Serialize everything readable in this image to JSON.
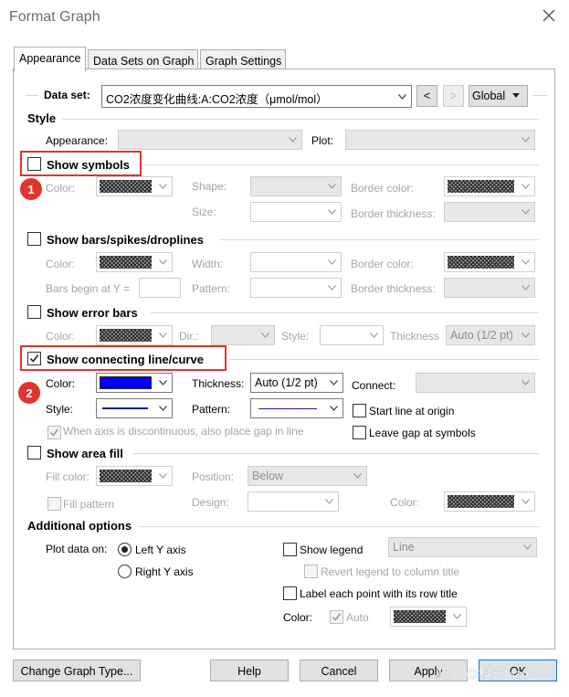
{
  "window": {
    "title": "Format Graph"
  },
  "tabs": [
    "Appearance",
    "Data Sets on Graph",
    "Graph Settings"
  ],
  "dataset": {
    "label": "Data set:",
    "value": "CO2浓度变化曲线:A:CO2浓度（μmol/mol）",
    "prev": "<",
    "next": ">",
    "scope": "Global"
  },
  "style": {
    "heading": "Style",
    "appearance_label": "Appearance:",
    "appearance_value": "",
    "plot_label": "Plot:",
    "plot_value": ""
  },
  "symbols": {
    "heading": "Show symbols",
    "checked": false,
    "color_label": "Color:",
    "shape_label": "Shape:",
    "size_label": "Size:",
    "border_color_label": "Border color:",
    "border_thickness_label": "Border thickness:"
  },
  "bars": {
    "heading": "Show bars/spikes/droplines",
    "checked": false,
    "color_label": "Color:",
    "width_label": "Width:",
    "border_color_label": "Border color:",
    "bars_begin_label": "Bars begin at Y =",
    "pattern_label": "Pattern:",
    "border_thickness_label": "Border thickness:"
  },
  "error_bars": {
    "heading": "Show error bars",
    "checked": false,
    "color_label": "Color:",
    "dir_label": "Dir.:",
    "style_label": "Style:",
    "thickness_label": "Thickness",
    "thickness_value": "Auto (1/2 pt)"
  },
  "line": {
    "heading": "Show connecting line/curve",
    "checked": true,
    "color_label": "Color:",
    "color_hex": "#0000ff",
    "thickness_label": "Thickness:",
    "thickness_value": "Auto (1/2 pt)",
    "connect_label": "Connect:",
    "connect_value": "",
    "style_label": "Style:",
    "pattern_label": "Pattern:",
    "start_origin_label": "Start line at origin",
    "start_origin_checked": false,
    "leave_gap_label": "Leave gap at symbols",
    "leave_gap_checked": false,
    "gap_label": "When axis is discontinuous, also place gap in line",
    "gap_checked": true
  },
  "area": {
    "heading": "Show area fill",
    "checked": false,
    "fill_color_label": "Fill color:",
    "position_label": "Position:",
    "position_value": "Below",
    "fill_pattern_label": "Fill pattern",
    "design_label": "Design:",
    "color_label": "Color:"
  },
  "additional": {
    "heading": "Additional options",
    "plot_on_label": "Plot data on:",
    "left_axis": "Left Y axis",
    "right_axis": "Right  Y axis",
    "selected_axis": "left",
    "show_legend_label": "Show legend",
    "legend_value": "Line",
    "revert_legend_label": "Revert legend to column title",
    "label_points_label": "Label each point with its row title",
    "color_label": "Color:",
    "auto_label": "Auto"
  },
  "buttons": {
    "change_type": "Change Graph Type...",
    "help": "Help",
    "cancel": "Cancel",
    "apply": "Apply",
    "ok": "OK"
  },
  "annotations": {
    "badge1": "1",
    "badge2": "2"
  },
  "watermark": "知乎 @科哥Man"
}
